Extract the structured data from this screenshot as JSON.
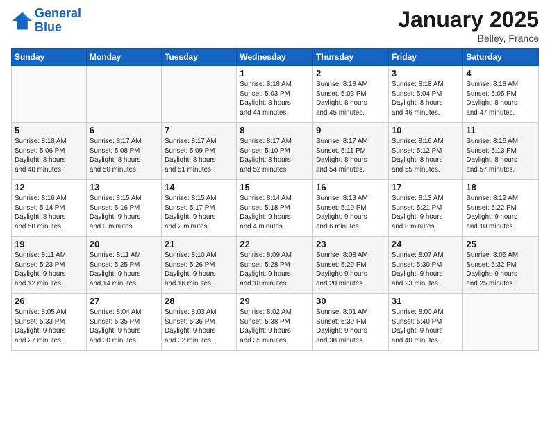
{
  "header": {
    "logo_line1": "General",
    "logo_line2": "Blue",
    "month": "January 2025",
    "location": "Belley, France"
  },
  "weekdays": [
    "Sunday",
    "Monday",
    "Tuesday",
    "Wednesday",
    "Thursday",
    "Friday",
    "Saturday"
  ],
  "weeks": [
    [
      {
        "day": "",
        "info": ""
      },
      {
        "day": "",
        "info": ""
      },
      {
        "day": "",
        "info": ""
      },
      {
        "day": "1",
        "info": "Sunrise: 8:18 AM\nSunset: 5:03 PM\nDaylight: 8 hours\nand 44 minutes."
      },
      {
        "day": "2",
        "info": "Sunrise: 8:18 AM\nSunset: 5:03 PM\nDaylight: 8 hours\nand 45 minutes."
      },
      {
        "day": "3",
        "info": "Sunrise: 8:18 AM\nSunset: 5:04 PM\nDaylight: 8 hours\nand 46 minutes."
      },
      {
        "day": "4",
        "info": "Sunrise: 8:18 AM\nSunset: 5:05 PM\nDaylight: 8 hours\nand 47 minutes."
      }
    ],
    [
      {
        "day": "5",
        "info": "Sunrise: 8:18 AM\nSunset: 5:06 PM\nDaylight: 8 hours\nand 48 minutes."
      },
      {
        "day": "6",
        "info": "Sunrise: 8:17 AM\nSunset: 5:08 PM\nDaylight: 8 hours\nand 50 minutes."
      },
      {
        "day": "7",
        "info": "Sunrise: 8:17 AM\nSunset: 5:09 PM\nDaylight: 8 hours\nand 51 minutes."
      },
      {
        "day": "8",
        "info": "Sunrise: 8:17 AM\nSunset: 5:10 PM\nDaylight: 8 hours\nand 52 minutes."
      },
      {
        "day": "9",
        "info": "Sunrise: 8:17 AM\nSunset: 5:11 PM\nDaylight: 8 hours\nand 54 minutes."
      },
      {
        "day": "10",
        "info": "Sunrise: 8:16 AM\nSunset: 5:12 PM\nDaylight: 8 hours\nand 55 minutes."
      },
      {
        "day": "11",
        "info": "Sunrise: 8:16 AM\nSunset: 5:13 PM\nDaylight: 8 hours\nand 57 minutes."
      }
    ],
    [
      {
        "day": "12",
        "info": "Sunrise: 8:16 AM\nSunset: 5:14 PM\nDaylight: 8 hours\nand 58 minutes."
      },
      {
        "day": "13",
        "info": "Sunrise: 8:15 AM\nSunset: 5:16 PM\nDaylight: 9 hours\nand 0 minutes."
      },
      {
        "day": "14",
        "info": "Sunrise: 8:15 AM\nSunset: 5:17 PM\nDaylight: 9 hours\nand 2 minutes."
      },
      {
        "day": "15",
        "info": "Sunrise: 8:14 AM\nSunset: 5:18 PM\nDaylight: 9 hours\nand 4 minutes."
      },
      {
        "day": "16",
        "info": "Sunrise: 8:13 AM\nSunset: 5:19 PM\nDaylight: 9 hours\nand 6 minutes."
      },
      {
        "day": "17",
        "info": "Sunrise: 8:13 AM\nSunset: 5:21 PM\nDaylight: 9 hours\nand 8 minutes."
      },
      {
        "day": "18",
        "info": "Sunrise: 8:12 AM\nSunset: 5:22 PM\nDaylight: 9 hours\nand 10 minutes."
      }
    ],
    [
      {
        "day": "19",
        "info": "Sunrise: 8:11 AM\nSunset: 5:23 PM\nDaylight: 9 hours\nand 12 minutes."
      },
      {
        "day": "20",
        "info": "Sunrise: 8:11 AM\nSunset: 5:25 PM\nDaylight: 9 hours\nand 14 minutes."
      },
      {
        "day": "21",
        "info": "Sunrise: 8:10 AM\nSunset: 5:26 PM\nDaylight: 9 hours\nand 16 minutes."
      },
      {
        "day": "22",
        "info": "Sunrise: 8:09 AM\nSunset: 5:28 PM\nDaylight: 9 hours\nand 18 minutes."
      },
      {
        "day": "23",
        "info": "Sunrise: 8:08 AM\nSunset: 5:29 PM\nDaylight: 9 hours\nand 20 minutes."
      },
      {
        "day": "24",
        "info": "Sunrise: 8:07 AM\nSunset: 5:30 PM\nDaylight: 9 hours\nand 23 minutes."
      },
      {
        "day": "25",
        "info": "Sunrise: 8:06 AM\nSunset: 5:32 PM\nDaylight: 9 hours\nand 25 minutes."
      }
    ],
    [
      {
        "day": "26",
        "info": "Sunrise: 8:05 AM\nSunset: 5:33 PM\nDaylight: 9 hours\nand 27 minutes."
      },
      {
        "day": "27",
        "info": "Sunrise: 8:04 AM\nSunset: 5:35 PM\nDaylight: 9 hours\nand 30 minutes."
      },
      {
        "day": "28",
        "info": "Sunrise: 8:03 AM\nSunset: 5:36 PM\nDaylight: 9 hours\nand 32 minutes."
      },
      {
        "day": "29",
        "info": "Sunrise: 8:02 AM\nSunset: 5:38 PM\nDaylight: 9 hours\nand 35 minutes."
      },
      {
        "day": "30",
        "info": "Sunrise: 8:01 AM\nSunset: 5:39 PM\nDaylight: 9 hours\nand 38 minutes."
      },
      {
        "day": "31",
        "info": "Sunrise: 8:00 AM\nSunset: 5:40 PM\nDaylight: 9 hours\nand 40 minutes."
      },
      {
        "day": "",
        "info": ""
      }
    ]
  ]
}
